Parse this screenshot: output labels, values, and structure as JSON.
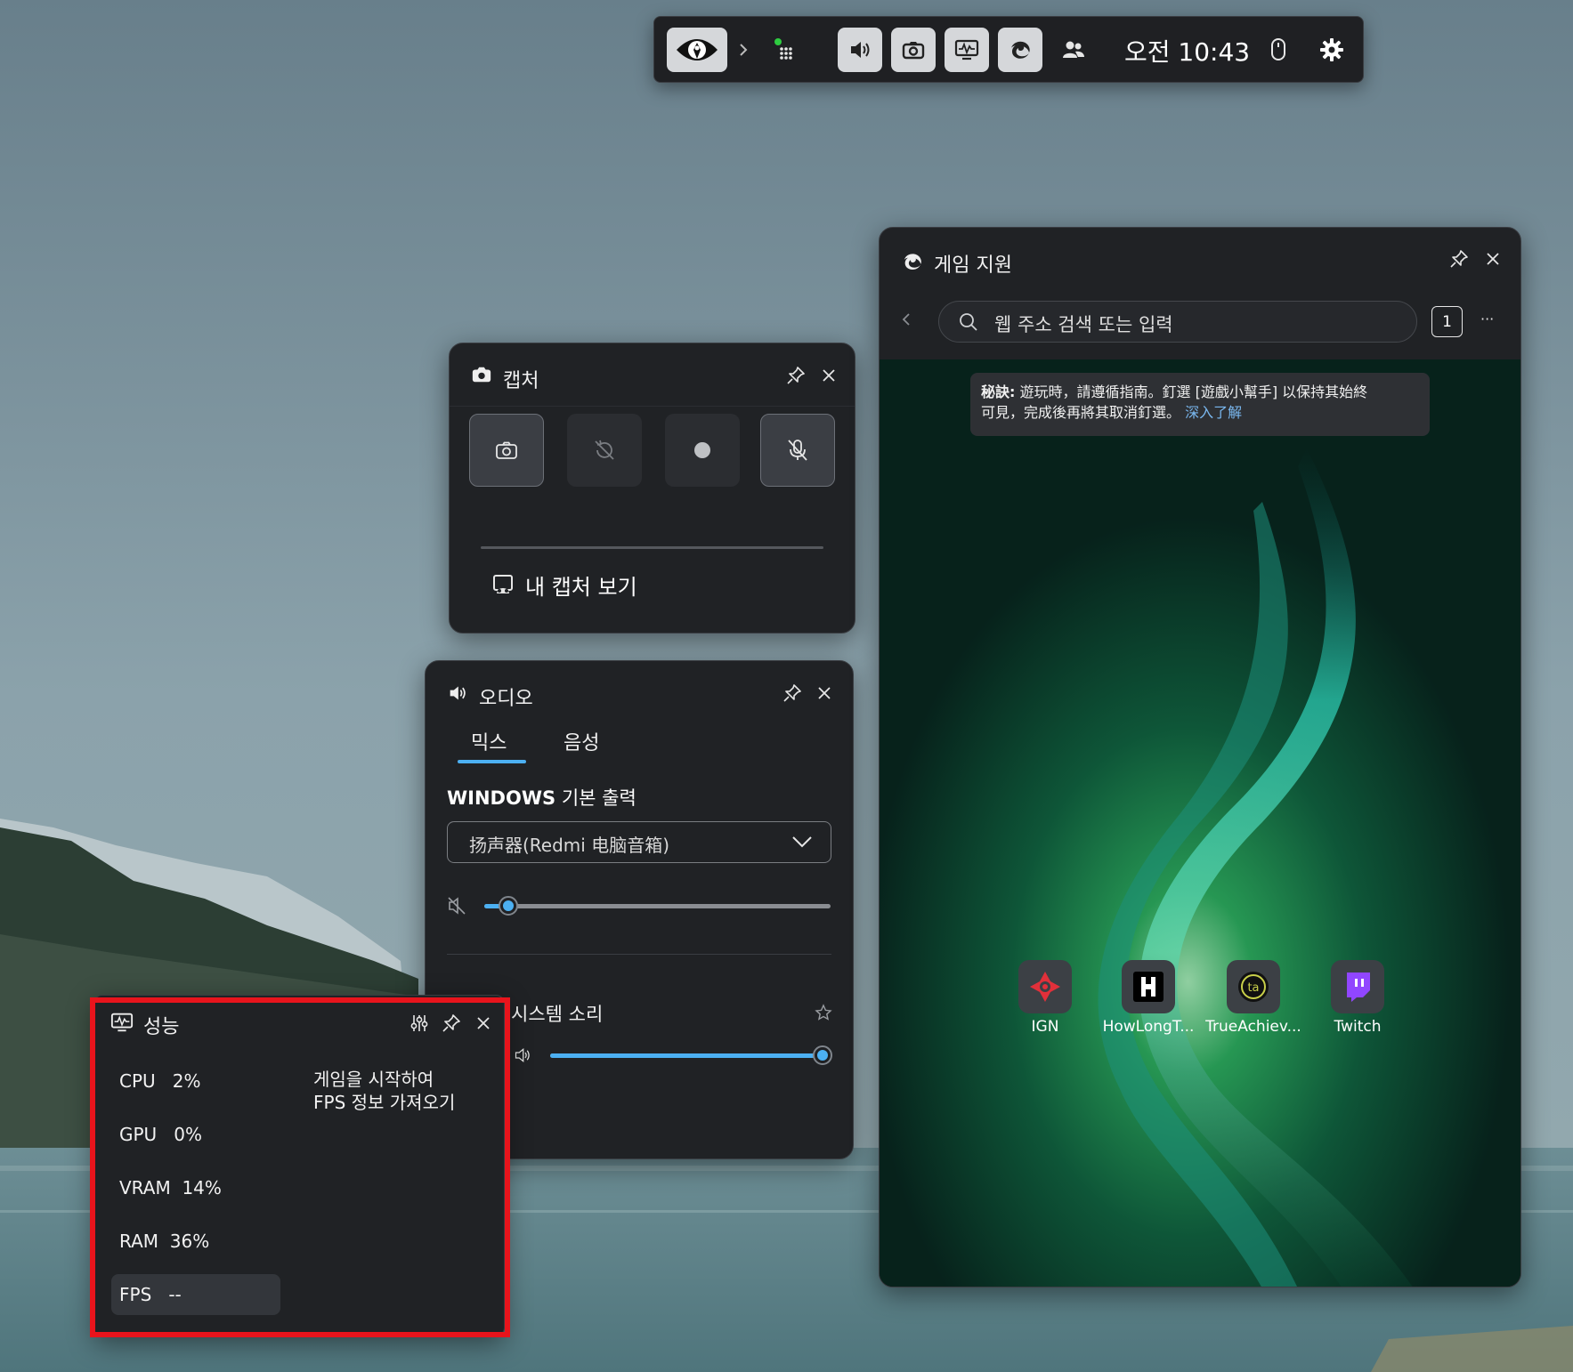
{
  "topbar": {
    "time": "오전 10:43",
    "buttons": [
      "eye-app-icon",
      "chevron-right-icon",
      "widget-menu-icon",
      "audio-icon",
      "capture-icon",
      "performance-icon",
      "edge-icon",
      "social-icon",
      "mouse-icon",
      "gear-icon"
    ]
  },
  "capture": {
    "title": "캡처",
    "see_captures": "내 캡처 보기"
  },
  "audio": {
    "title": "오디오",
    "tabs": [
      "믹스",
      "음성"
    ],
    "active_tab": "믹스",
    "section_label_latin": "WINDOWS",
    "section_label_rest": "기본 출력",
    "device": "扬声器(Redmi 电脑音箱)",
    "master_volume_fraction": 0.07,
    "system_sound_label": "시스템 소리",
    "system_volume_fraction": 0.97
  },
  "performance": {
    "title": "성능",
    "cpu_label": "CPU",
    "cpu_value": "2%",
    "gpu_label": "GPU",
    "gpu_value": "0%",
    "vram_label": "VRAM",
    "vram_value": "14%",
    "ram_label": "RAM",
    "ram_value": "36%",
    "fps_label": "FPS",
    "fps_value": "--",
    "fps_hint_line1": "게임을 시작하여",
    "fps_hint_line2": "FPS 정보 가져오기"
  },
  "game_assist": {
    "title": "게임 지원",
    "search_placeholder": "웹 주소 검색 또는 입력",
    "tab_count": "1",
    "more": "···",
    "tip_bold": "秘訣:",
    "tip_text_line1": " 遊玩時，請遵循指南。釘選 [遊戲小幫手] 以保持其始終",
    "tip_text_line2": "可見，完成後再將其取消釘選。",
    "tip_link": "深入了解",
    "tiles": [
      "IGN",
      "HowLongT...",
      "TrueAchiev...",
      "Twitch"
    ],
    "colors": {
      "ign": "#e1303a",
      "twitch": "#9146ff",
      "accent": "#4cb0f2"
    }
  },
  "highlight_color": "#e8141c"
}
